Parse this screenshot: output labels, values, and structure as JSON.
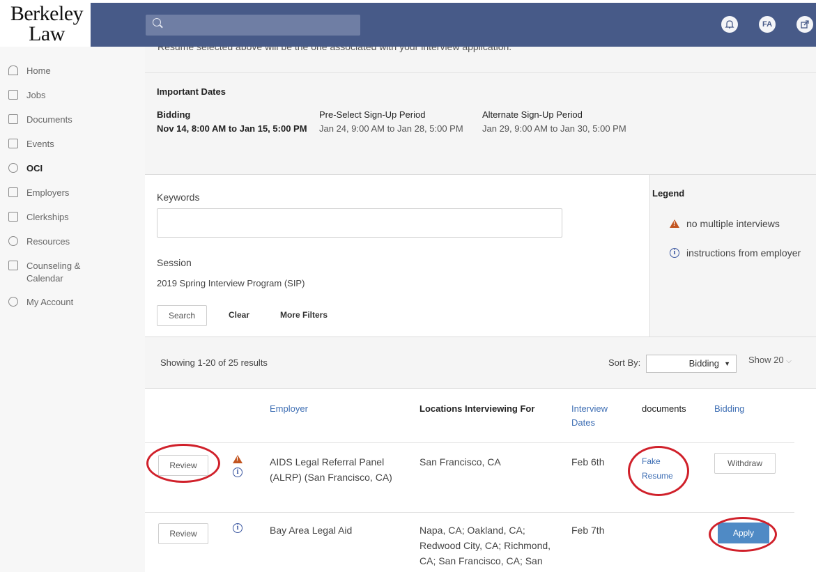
{
  "brand": {
    "line1": "Berkeley",
    "line2": "Law"
  },
  "header": {
    "search_placeholder": "",
    "avatar_initials": "FA",
    "icons": [
      "search-icon",
      "bell-icon",
      "external-link-icon"
    ]
  },
  "sidebar": {
    "items": [
      {
        "label": "Home",
        "icon": "home-icon",
        "active": false
      },
      {
        "label": "Jobs",
        "icon": "briefcase-icon",
        "active": false
      },
      {
        "label": "Documents",
        "icon": "document-icon",
        "active": false
      },
      {
        "label": "Events",
        "icon": "calendar-icon",
        "active": false
      },
      {
        "label": "OCI",
        "icon": "interview-icon",
        "active": true
      },
      {
        "label": "Employers",
        "icon": "building-icon",
        "active": false
      },
      {
        "label": "Clerkships",
        "icon": "scales-icon",
        "active": false
      },
      {
        "label": "Resources",
        "icon": "lightbulb-icon",
        "active": false
      },
      {
        "label": "Counseling & Calendar",
        "icon": "calendar-icon",
        "active": false
      },
      {
        "label": "My Account",
        "icon": "gear-icon",
        "active": false
      }
    ]
  },
  "notice": {
    "text": "Resume selected above will be the one associated with your interview application."
  },
  "important_dates": {
    "title": "Important Dates",
    "periods": [
      {
        "title": "Bidding",
        "range": "Nov 14, 8:00 AM to Jan 15, 5:00 PM"
      },
      {
        "title": "Pre-Select Sign-Up Period",
        "range": "Jan 24, 9:00 AM to Jan 28, 5:00 PM"
      },
      {
        "title": "Alternate Sign-Up Period",
        "range": "Jan 29, 9:00 AM to Jan 30, 5:00 PM"
      }
    ]
  },
  "filters": {
    "keywords_label": "Keywords",
    "keywords_value": "",
    "session_label": "Session",
    "session_value": "2019 Spring Interview Program (SIP)",
    "search_button": "Search",
    "clear_button": "Clear",
    "more_filters_button": "More Filters"
  },
  "legend": {
    "title": "Legend",
    "items": [
      {
        "icon": "warning-icon",
        "label": "no multiple interviews"
      },
      {
        "icon": "info-icon",
        "label": "instructions from employer"
      }
    ]
  },
  "results": {
    "showing": "Showing 1-20 of 25 results",
    "sort_label": "Sort By:",
    "sort_value": "Bidding",
    "page_size": "Show 20"
  },
  "table": {
    "headers": {
      "employer": "Employer",
      "locations": "Locations Interviewing For",
      "dates_line1": "Interview",
      "dates_line2": "Dates",
      "documents": "documents",
      "bidding": "Bidding"
    },
    "rows": [
      {
        "review": "Review",
        "employer_line1": "AIDS Legal Referral Panel",
        "employer_line2": "(ALRP) (San Francisco, CA)",
        "locations": [
          "San Francisco, CA"
        ],
        "date": "Feb 6th",
        "doc_line1": "Fake",
        "doc_line2": "Resume",
        "action": "Withdraw",
        "icons": [
          "warning-icon",
          "info-icon"
        ]
      },
      {
        "review": "Review",
        "employer_line1": "Bay Area Legal Aid",
        "employer_line2": "",
        "locations": [
          "Napa, CA; Oakland, CA;",
          "Redwood City, CA; Richmond,",
          "CA; San Francisco, CA; San"
        ],
        "date": "Feb 7th",
        "doc_line1": "",
        "doc_line2": "",
        "action": "Apply",
        "icons": [
          "info-icon"
        ]
      }
    ]
  },
  "colors": {
    "nav_band": "#475a88",
    "link": "#3f6fb4",
    "apply": "#4f8ac5",
    "annotation": "#d0202a",
    "warning": "#c2541f"
  }
}
